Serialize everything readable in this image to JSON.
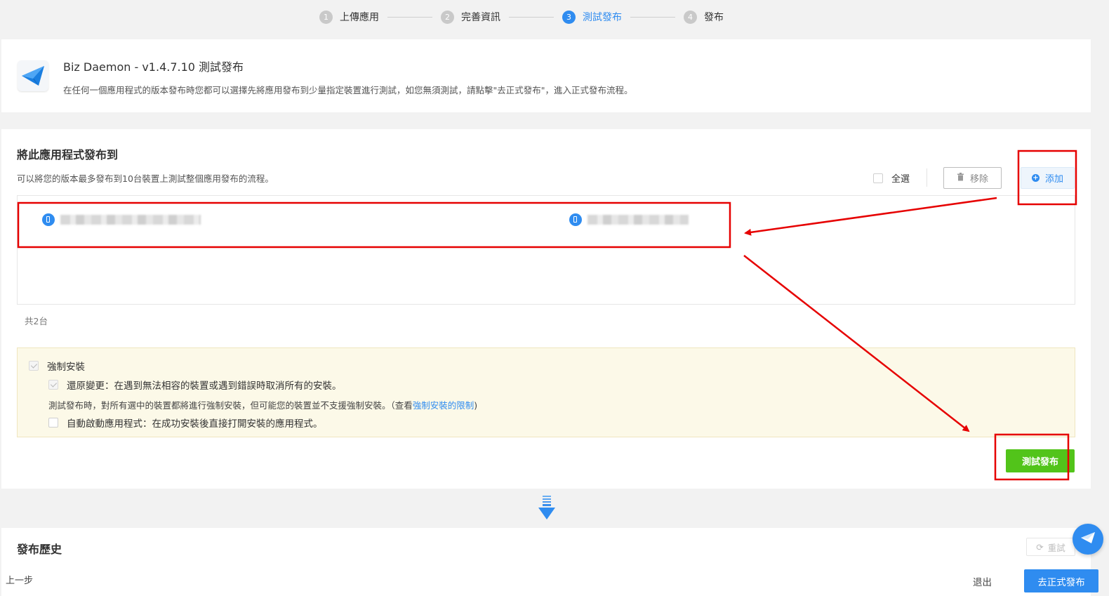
{
  "stepper": {
    "steps": [
      {
        "num": "1",
        "label": "上傳應用",
        "state": "done"
      },
      {
        "num": "2",
        "label": "完善資訊",
        "state": "done"
      },
      {
        "num": "3",
        "label": "測試發布",
        "state": "active"
      },
      {
        "num": "4",
        "label": "發布",
        "state": "todo"
      }
    ]
  },
  "app": {
    "title": "Biz Daemon - v1.4.7.10 測試發布",
    "description": "在任何一個應用程式的版本發布時您都可以選擇先將應用發布到少量指定裝置進行測試，如您無須測試，請點擊\"去正式發布\"，進入正式發布流程。",
    "icon": "paper-plane-icon"
  },
  "distribute": {
    "title": "將此應用程式發布到",
    "description": "可以將您的版本最多發布到10台裝置上測試整個應用發布的流程。",
    "select_all_label": "全選",
    "remove_label": "移除",
    "add_label": "添加",
    "devices": [
      {
        "icon": "phone-icon",
        "name_redacted": true
      },
      {
        "icon": "phone-icon",
        "name_redacted": true
      }
    ],
    "count_text": "共2台"
  },
  "options": {
    "force_install_label": "強制安裝",
    "revert_label": "還原變更：在遇到無法相容的裝置或遇到錯誤時取消所有的安裝。",
    "note_prefix": "測試發布時，對所有選中的裝置都將進行強制安裝，但可能您的裝置並不支援強制安裝。（查看",
    "note_link": "強制安裝的限制",
    "note_suffix": ")",
    "auto_launch_label": "自動啟動應用程式：在成功安裝後直接打開安裝的應用程式。"
  },
  "test_publish_label": "測試發布",
  "history": {
    "title": "發布歷史",
    "retry_label": "重試"
  },
  "footer": {
    "prev_label": "上一步",
    "exit_label": "退出",
    "formal_publish_label": "去正式發布"
  },
  "colors": {
    "accent": "#2f8cf0",
    "success": "#52c41a",
    "annotation": "#e60000",
    "notice_bg": "#fcf9e8"
  }
}
